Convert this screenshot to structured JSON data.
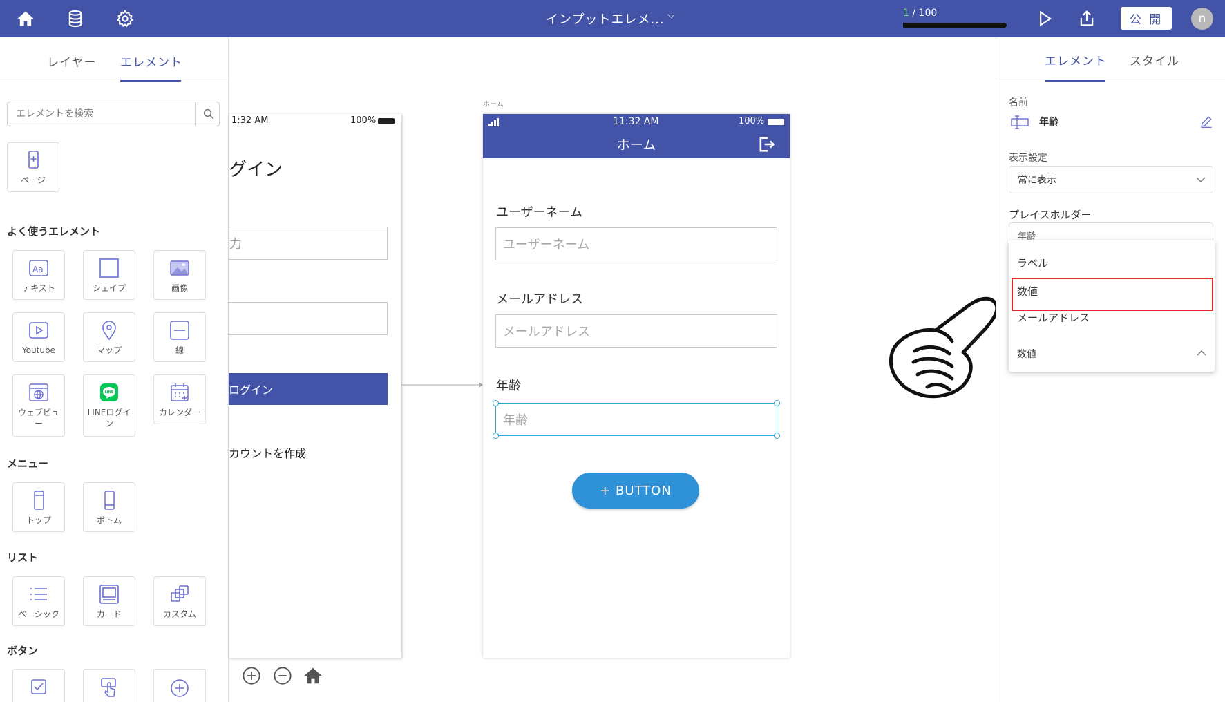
{
  "topbar": {
    "title": "インプットエレメ...",
    "counter_current": "1",
    "counter_rest": " / 100",
    "progress_fraction": 0.01,
    "publish_label": "公 開",
    "avatar_initial": "n"
  },
  "left_panel": {
    "tabs": [
      "レイヤー",
      "エレメント"
    ],
    "search_placeholder": "エレメントを検索",
    "page_tile": "ページ",
    "sections": {
      "common": "よく使うエレメント",
      "menu": "メニュー",
      "list": "リスト",
      "button": "ボタン"
    },
    "common_tiles": [
      "テキスト",
      "シェイプ",
      "画像",
      "Youtube",
      "マップ",
      "線",
      "ウェブビュー",
      "LINEログイン",
      "カレンダー"
    ],
    "menu_tiles": [
      "トップ",
      "ボトム"
    ],
    "list_tiles": [
      "ベーシック",
      "カード",
      "カスタム"
    ]
  },
  "canvas": {
    "phone1": {
      "time": "1:32 AM",
      "battery": "100%",
      "title": "グイン",
      "input1": "力",
      "login_button": "ログイン",
      "create_account": "カウントを作成"
    },
    "phone2": {
      "frame_label": "ホーム",
      "time": "11:32 AM",
      "battery": "100%",
      "header_title": "ホーム",
      "fields": [
        {
          "label": "ユーザーネーム",
          "placeholder": "ユーザーネーム"
        },
        {
          "label": "メールアドレス",
          "placeholder": "メールアドレス"
        },
        {
          "label": "年齢",
          "placeholder": "年齢"
        }
      ],
      "button_label": "+  BUTTON"
    }
  },
  "right_panel": {
    "tabs": [
      "エレメント",
      "スタイル"
    ],
    "name_label": "名前",
    "name_value": "年齢",
    "visibility_label": "表示設定",
    "visibility_value": "常に表示",
    "placeholder_label": "プレイスホルダー",
    "placeholder_value": "年齢",
    "dropdown_options": [
      "ラベル",
      "数値",
      "メールアドレス"
    ],
    "dropdown_selected": "数値"
  },
  "colors": {
    "brand": "#4354a8",
    "button_blue": "#2f92d8",
    "highlight_red": "#e0282e",
    "selection": "#2aa6cc"
  }
}
